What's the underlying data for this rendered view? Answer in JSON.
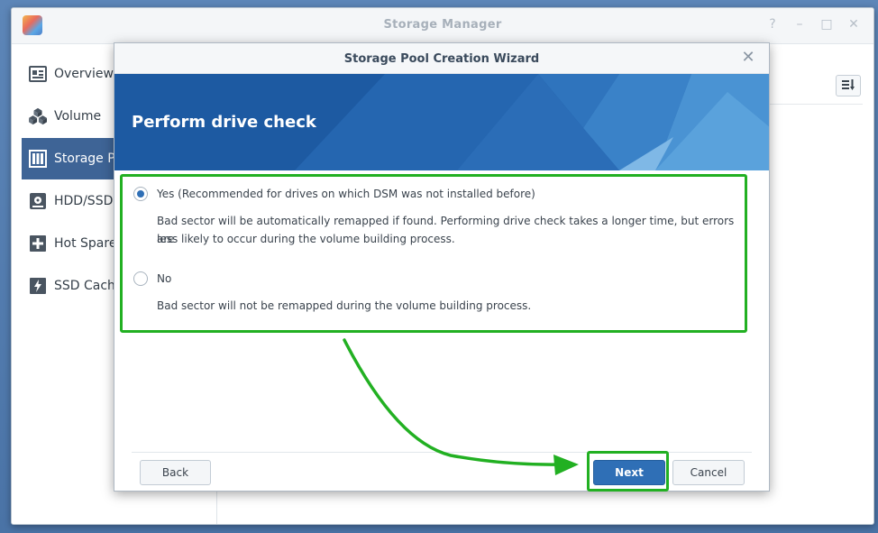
{
  "window": {
    "title": "Storage Manager",
    "controls": [
      "?",
      "–",
      "□",
      "✕"
    ]
  },
  "sidebar": {
    "items": [
      {
        "label": "Overview",
        "icon": "overview-icon",
        "active": false
      },
      {
        "label": "Volume",
        "icon": "volume-cubes-icon",
        "active": false
      },
      {
        "label": "Storage Po",
        "icon": "storage-pool-icon",
        "active": true
      },
      {
        "label": "HDD/SSD",
        "icon": "hdd-icon",
        "active": false
      },
      {
        "label": "Hot Spare",
        "icon": "hot-spare-plus-icon",
        "active": false
      },
      {
        "label": "SSD Cach",
        "icon": "ssd-cache-bolt-icon",
        "active": false
      }
    ]
  },
  "wizard": {
    "title": "Storage Pool Creation Wizard",
    "heading": "Perform drive check",
    "options": [
      {
        "label": "Yes (Recommended for drives on which DSM was not installed before)",
        "description_line1": "Bad sector will be automatically remapped if found. Performing drive check takes a longer time, but errors are",
        "description_line2": "less likely to occur during the volume building process.",
        "checked": true
      },
      {
        "label": "No",
        "description_line1": "Bad sector will not be remapped during the volume building process.",
        "checked": false
      }
    ],
    "buttons": {
      "back": "Back",
      "next": "Next",
      "cancel": "Cancel"
    }
  },
  "colors": {
    "accent": "#2f6fb6",
    "sidebar_active": "#3e6496",
    "banner": "#1f5fa8",
    "highlight": "#22b022"
  }
}
